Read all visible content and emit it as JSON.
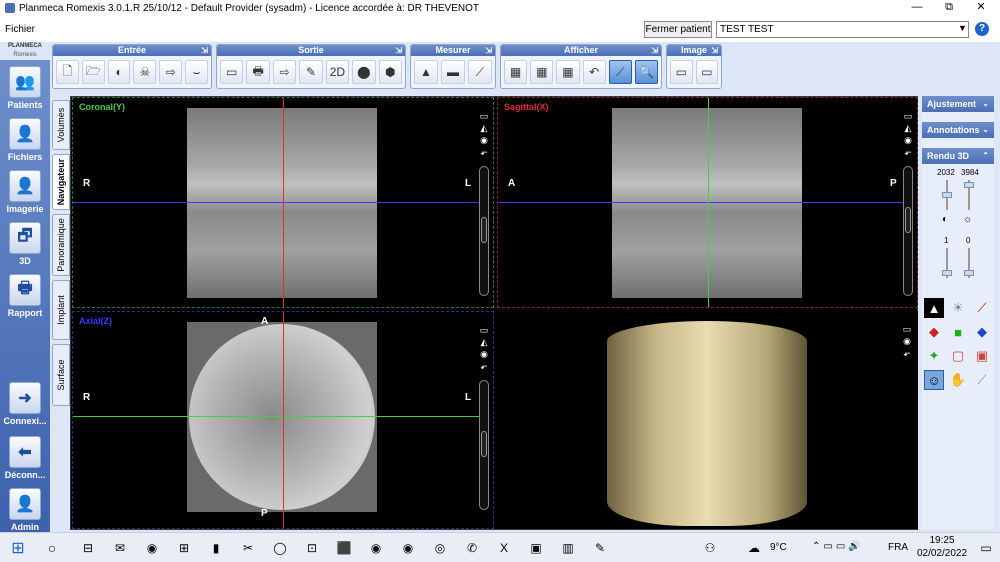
{
  "window": {
    "title": "Planmeca Romexis 3.0.1.R  25/10/12 - Default Provider (sysadm) - Licence accordée à: DR THEVENOT",
    "minimize": "—",
    "maximize": "⧉",
    "close": "✕"
  },
  "menu": {
    "file": "Fichier",
    "close_patient": "Fermer patient",
    "patient_name": "TEST TEST",
    "dropdown": "▼",
    "help": "?"
  },
  "logo": {
    "line1": "PLANMECA",
    "line2": "Romexis"
  },
  "sidebar": [
    {
      "label": "Patients",
      "icon": "👥"
    },
    {
      "label": "Fichiers",
      "icon": "👤"
    },
    {
      "label": "Imagerie",
      "icon": "👤"
    },
    {
      "label": "3D",
      "icon": "🗗"
    },
    {
      "label": "Rapport",
      "icon": "🖶"
    },
    {
      "label": "Connexi...",
      "icon": "➜"
    },
    {
      "label": "Déconn...",
      "icon": "⬅"
    },
    {
      "label": "Admin",
      "icon": "👤"
    }
  ],
  "vtabs": [
    "Volumes",
    "Navigateur",
    "Panoramique",
    "Implant",
    "Surface"
  ],
  "toolbar": {
    "groups": [
      {
        "title": "Entrée",
        "icons": [
          "🗋",
          "🗁",
          "◐",
          "☠",
          "⇨",
          "⌣"
        ]
      },
      {
        "title": "Sortie",
        "icons": [
          "▭",
          "🖶",
          "⇨",
          "✎",
          "2D",
          "⬤",
          "⬢"
        ]
      },
      {
        "title": "Mesurer",
        "icons": [
          "▲",
          "▬",
          "⟋"
        ]
      },
      {
        "title": "Afficher",
        "icons": [
          "▦",
          "▦",
          "▦",
          "↶",
          "⟋",
          "🔍"
        ]
      },
      {
        "title": "Image",
        "icons": [
          "▭",
          "▭"
        ]
      }
    ],
    "expand": "⇲"
  },
  "views": {
    "coronal": {
      "label": "Coronal(Y)",
      "left": "R",
      "right": "L",
      "color": "#44d044"
    },
    "sagittal": {
      "label": "Sagittal(X)",
      "left": "A",
      "right": "P",
      "color": "#e03030"
    },
    "axial": {
      "label": "Axial(Z)",
      "left": "R",
      "right": "L",
      "top": "A",
      "bottom": "P",
      "color": "#3a3aff"
    },
    "tools": [
      "▭",
      "◭",
      "◉",
      "⬐"
    ]
  },
  "right_panel": {
    "adjust": "Ajustement",
    "annotations": "Annotations",
    "render": "Rendu 3D",
    "chev_down": "⌄",
    "chev_up": "⌃",
    "val1": "2032",
    "val2": "3984",
    "val3": "1",
    "val4": "0"
  },
  "taskbar": {
    "start": "⊞",
    "search": "○",
    "time": "19:25",
    "date": "02/02/2022",
    "lang": "FRA",
    "weather": "9°C",
    "apps": [
      "⊟",
      "✉",
      "◉",
      "⊞",
      "▮",
      "✂",
      "◯",
      "⊡",
      "⬛",
      "◉",
      "◉",
      "◎",
      "✆",
      "X",
      "▣",
      "▥",
      "✎"
    ]
  },
  "colors": {
    "accent": "#4a6fb5",
    "coronal": "#44d044",
    "sagittal": "#e03030",
    "axial": "#3a3aff"
  }
}
